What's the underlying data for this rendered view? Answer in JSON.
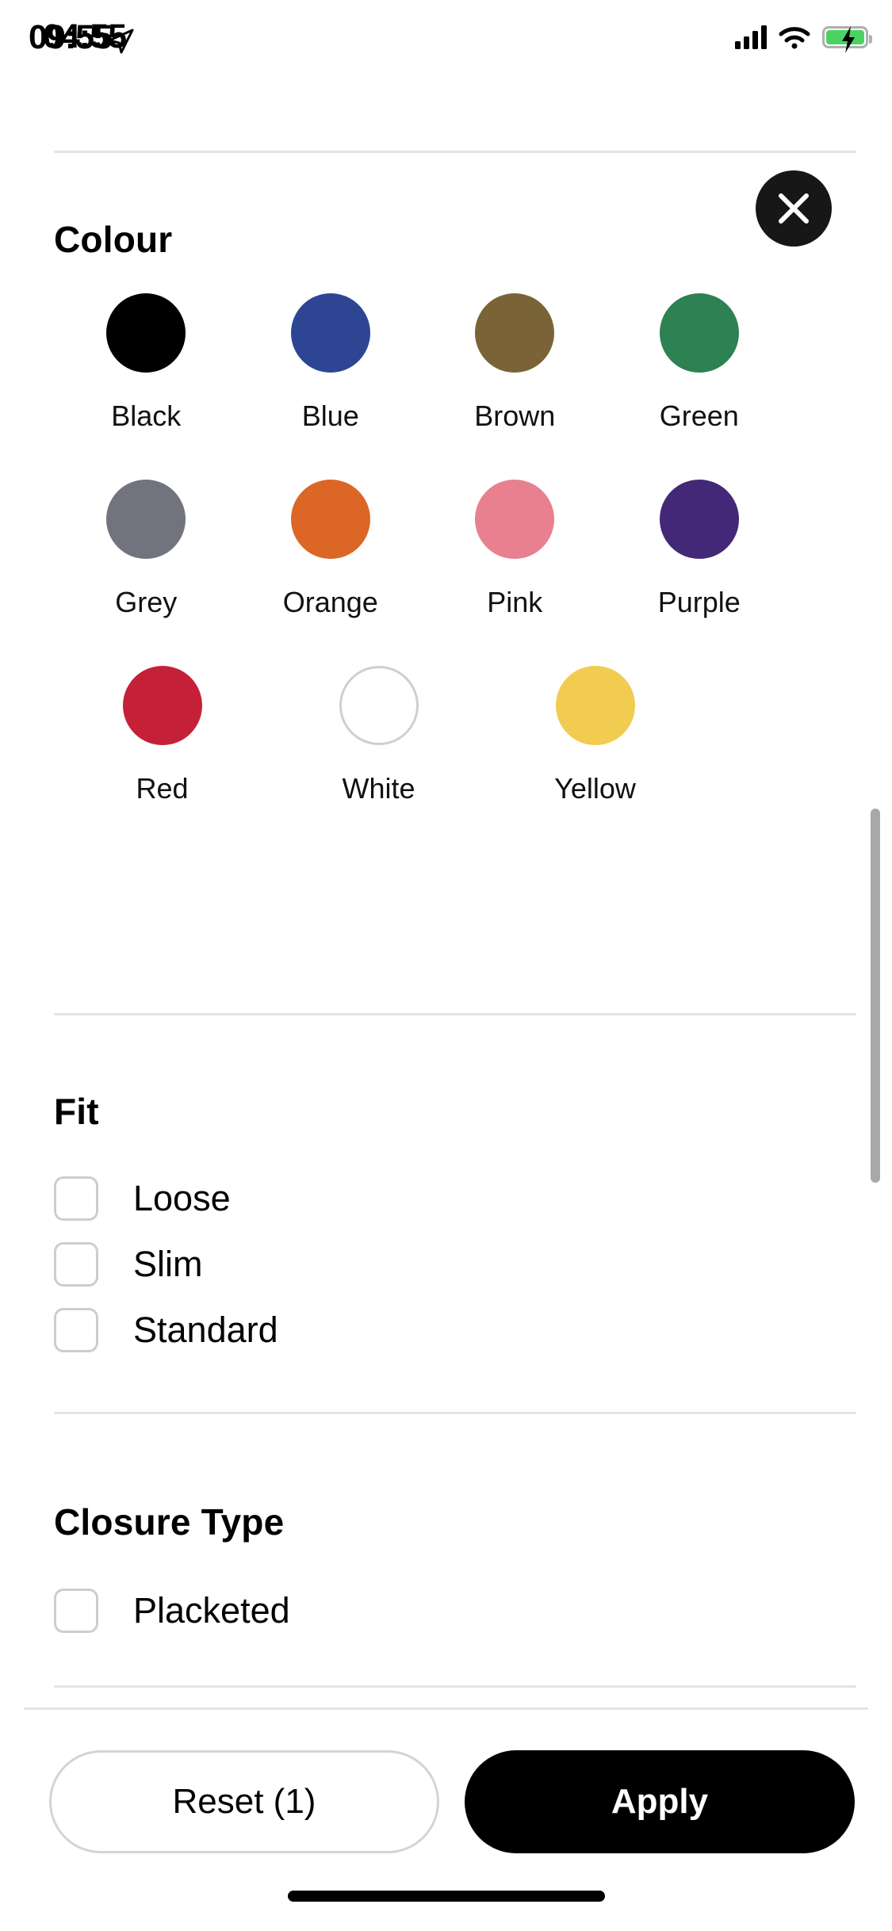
{
  "status_bar": {
    "time": "09:55",
    "time_overlap": "04:55",
    "location_icon": "location-arrow-icon",
    "signal_icon": "cellular-signal-icon",
    "wifi_icon": "wifi-icon",
    "battery_icon": "battery-charging-icon",
    "battery_color": "#4cd263"
  },
  "sheet": {
    "close_icon": "close-icon",
    "close_bg": "#171717"
  },
  "colour": {
    "title": "Colour",
    "rows": [
      [
        {
          "label": "Black",
          "hex": "#000000",
          "outlined": false
        },
        {
          "label": "Blue",
          "hex": "#2E4593",
          "outlined": false
        },
        {
          "label": "Brown",
          "hex": "#7A6336",
          "outlined": false
        },
        {
          "label": "Green",
          "hex": "#2E8152",
          "outlined": false
        }
      ],
      [
        {
          "label": "Grey",
          "hex": "#71737F",
          "outlined": false
        },
        {
          "label": "Orange",
          "hex": "#DC6626",
          "outlined": false
        },
        {
          "label": "Pink",
          "hex": "#E8808F",
          "outlined": false
        },
        {
          "label": "Purple",
          "hex": "#442878",
          "outlined": false
        }
      ],
      [
        {
          "label": "Red",
          "hex": "#C42139",
          "outlined": false
        },
        {
          "label": "White",
          "hex": "#FFFFFF",
          "outlined": true
        },
        {
          "label": "Yellow",
          "hex": "#F2CB51",
          "outlined": false
        }
      ]
    ]
  },
  "fit": {
    "title": "Fit",
    "options": [
      {
        "label": "Loose",
        "checked": false
      },
      {
        "label": "Slim",
        "checked": false
      },
      {
        "label": "Standard",
        "checked": false
      }
    ]
  },
  "closure_type": {
    "title": "Closure Type",
    "options": [
      {
        "label": "Placketed",
        "checked": false
      }
    ]
  },
  "footer": {
    "reset_label": "Reset (1)",
    "apply_label": "Apply",
    "apply_bg": "#000000"
  }
}
